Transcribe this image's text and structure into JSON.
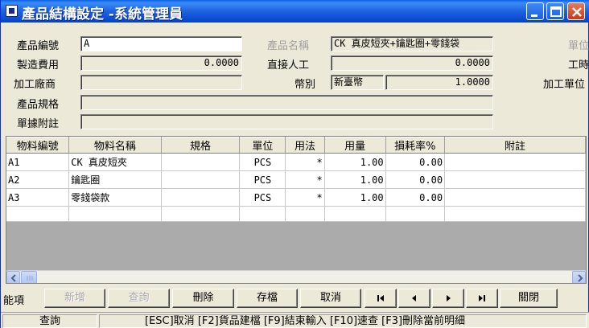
{
  "window": {
    "title": "產品結構設定 -系統管理員"
  },
  "form": {
    "product_code_label": "產品編號",
    "product_code": "A",
    "product_name_label": "產品名稱",
    "product_name": "CK 真皮短夾+鑰匙圈+零錢袋",
    "unit_label": "單位",
    "mfg_cost_label": "製造費用",
    "mfg_cost": "0.0000",
    "direct_labor_label": "直接人工",
    "direct_labor": "0.0000",
    "work_hours_label": "工時",
    "factory_label": "加工廠商",
    "factory": "",
    "currency_label": "幣別",
    "currency": "新臺幣",
    "exchange_rate": "1.0000",
    "processing_unit_label": "加工單位",
    "spec_label": "產品規格",
    "spec": "",
    "note_label": "單據附註",
    "note": ""
  },
  "grid": {
    "columns": [
      "物料編號",
      "物料名稱",
      "規格",
      "單位",
      "用法",
      "用量",
      "損耗率%",
      "附註"
    ],
    "rows": [
      [
        "A1",
        "CK 真皮短夾",
        "",
        "PCS",
        "*",
        "1.00",
        "0.00",
        ""
      ],
      [
        "A2",
        "鑰匙圈",
        "",
        "PCS",
        "*",
        "1.00",
        "0.00",
        ""
      ],
      [
        "A3",
        "零錢袋款",
        "",
        "PCS",
        "*",
        "1.00",
        "0.00",
        ""
      ],
      [
        "",
        "",
        "",
        "",
        "",
        "",
        "",
        ""
      ]
    ]
  },
  "toolbar": {
    "function_label": "能項",
    "add": "新增",
    "query": "查詢",
    "delete": "刪除",
    "save": "存檔",
    "cancel": "取消",
    "close": "關閉"
  },
  "status": {
    "mode": "查詢",
    "hint": "[ESC]取消 [F2]貨品建檔 [F9]結束輸入 [F10]速查 [F3]刪除當前明細"
  }
}
